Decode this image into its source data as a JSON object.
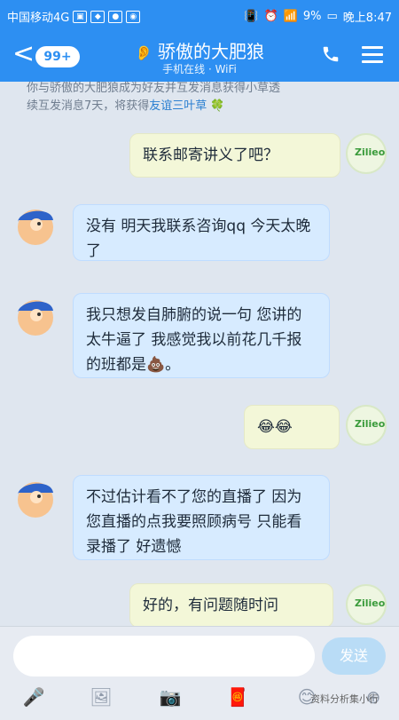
{
  "status": {
    "carrier": "中国移动4G",
    "battery": "9%",
    "time": "晚上8:47"
  },
  "header": {
    "back_label": "<",
    "badge": "99+",
    "title": "骄傲的大肥狼",
    "subtitle": "手机在线 · WiFi"
  },
  "notice": {
    "line1": "你与骄傲的大肥狼成为好友并互发消息获得小草透",
    "line2": "续互发消息7天，将获得",
    "link": "友谊三叶草"
  },
  "messages": [
    {
      "side": "right",
      "text": "联系邮寄讲义了吧？"
    },
    {
      "side": "left",
      "text": "没有 明天我联系咨询qq 今天太晚了"
    },
    {
      "side": "left",
      "text": "我只想发自肺腑的说一句 您讲的太牛逼了 我感觉我以前花几千报的班都是💩。"
    },
    {
      "side": "right",
      "text": "😂😂"
    },
    {
      "side": "left",
      "text": "不过估计看不了您的直播了 因为您直播的点我要照顾病号 只能看录播了 好遗憾"
    },
    {
      "side": "right",
      "text": "好的，有问题随时问"
    }
  ],
  "composer": {
    "send_label": "发送"
  },
  "watermark": "资料分析集小行"
}
